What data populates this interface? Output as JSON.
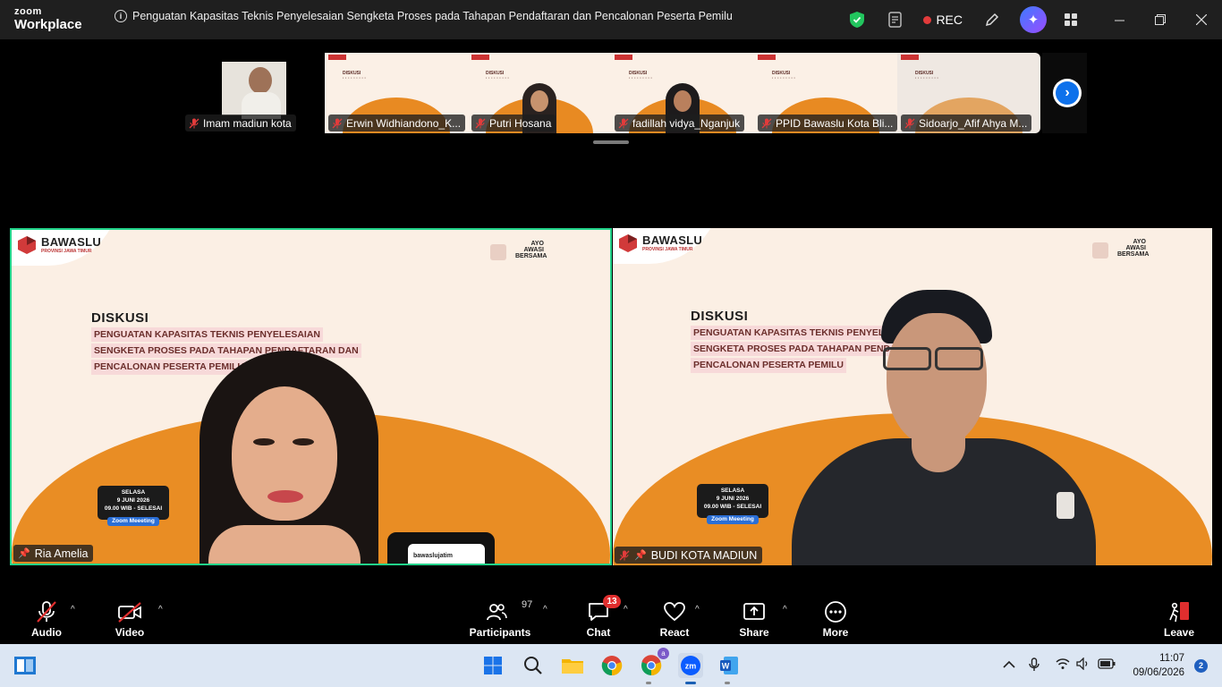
{
  "app": {
    "brand_top": "zoom",
    "brand_bottom": "Workplace"
  },
  "meeting": {
    "title": "Penguatan Kapasitas Teknis Penyelesaian Sengketa Proses pada Tahapan Pendaftaran dan Pencalonan Peserta Pemilu"
  },
  "titlebar": {
    "rec_label": "REC"
  },
  "thumbnails": [
    {
      "name": "Imam madiun kota"
    },
    {
      "name": "Erwin Widhiandono_K..."
    },
    {
      "name": "Putri Hosana"
    },
    {
      "name": "fadillah vidya_Nganjuk"
    },
    {
      "name": "PPID Bawaslu Kota Bli..."
    },
    {
      "name": "Sidoarjo_Afif Ahya M..."
    }
  ],
  "slide": {
    "org": "BAWASLU",
    "org_sub": "PROVINSI JAWA TIMUR",
    "ayo": "AYO AWASI BERSAMA",
    "heading": "DISKUSI",
    "line1": "PENGUATAN KAPASITAS TEKNIS PENYELESAIAN",
    "line2": "SENGKETA PROSES PADA TAHAPAN PENDAFTARAN DAN",
    "line3": "PENCALONAN PESERTA PEMILU",
    "date_day": "SELASA",
    "date": "9 JUNI 2026",
    "time": "09.00 WIB - SELESAI",
    "platform": "Zoom Meeeting",
    "handle": "bawaslujatim"
  },
  "tiles": [
    {
      "name": "Ria Amelia",
      "active": true
    },
    {
      "name": "BUDI KOTA MADIUN",
      "active": false
    }
  ],
  "toolbar": {
    "audio": "Audio",
    "video": "Video",
    "participants": "Participants",
    "participants_count": "97",
    "chat": "Chat",
    "chat_badge": "13",
    "react": "React",
    "share": "Share",
    "more": "More",
    "leave": "Leave"
  },
  "taskbar": {
    "time": "11:07",
    "date": "09/06/2026",
    "notifications": "2",
    "copilot_badge": "a"
  },
  "colors": {
    "active_border": "#22d38a",
    "zoom_blue": "#0e71eb",
    "slide_orange": "#e98d24",
    "leave_red": "#e02e2e"
  }
}
